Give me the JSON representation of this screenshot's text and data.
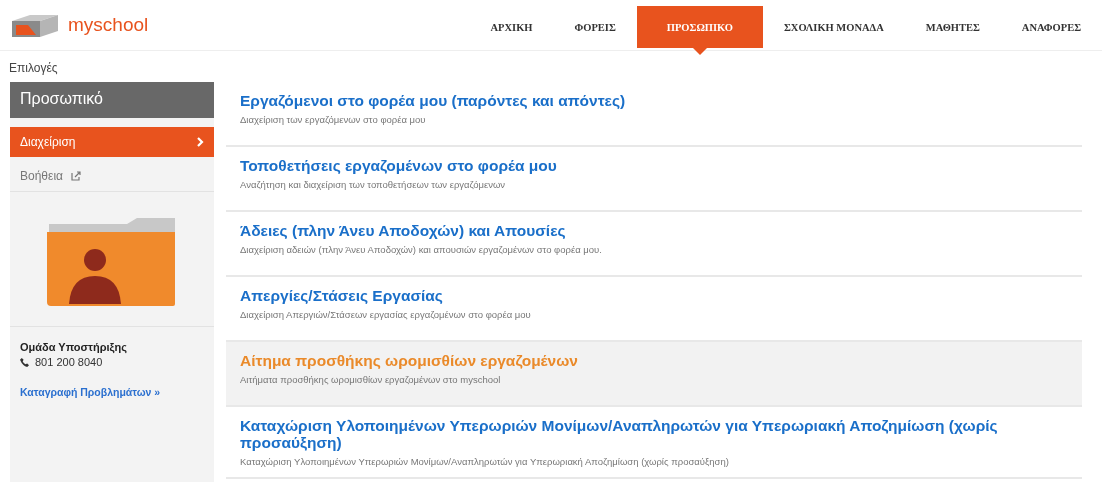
{
  "header": {
    "logo": "myschool",
    "nav": [
      {
        "label": "ΑΡΧΙΚΗ",
        "selected": false
      },
      {
        "label": "ΦΟΡΕΙΣ",
        "selected": false
      },
      {
        "label": "ΠΡΟΣΩΠΙΚΟ",
        "selected": true
      },
      {
        "label": "ΣΧΟΛΙΚΗ ΜΟΝΑΔΑ",
        "selected": false
      },
      {
        "label": "ΜΑΘΗΤΕΣ",
        "selected": false
      },
      {
        "label": "ΑΝΑΦΟΡΕΣ",
        "selected": false
      }
    ]
  },
  "breadcrumb": "Επιλογές",
  "sidebar": {
    "title": "Προσωπικό",
    "items": [
      {
        "label": "Διαχείριση",
        "selected": true,
        "kind": "arrow"
      },
      {
        "label": "Βοήθεια",
        "selected": false,
        "kind": "external"
      }
    ],
    "support": {
      "title": "Ομάδα Υποστήριξης",
      "phone": "801 200 8040",
      "link": "Καταγραφή Προβλημάτων »"
    }
  },
  "items": [
    {
      "title": "Εργαζόμενοι στο φορέα μου (παρόντες και απόντες)",
      "description": "Διαχείριση των εργαζόμενων στο φορέα μου",
      "highlighted": false
    },
    {
      "title": "Τοποθετήσεις εργαζομένων στο φορέα μου",
      "description": "Αναζήτηση και διαχείριση των τοποθετήσεων των εργαζόμενων",
      "highlighted": false
    },
    {
      "title": "Άδειες (πλην Άνευ Αποδοχών) και Απουσίες",
      "description": "Διαχείριση αδειών (πλην Άνευ Αποδοχών) και απουσιών εργαζομένων στο φορέα μου.",
      "highlighted": false
    },
    {
      "title": "Απεργίες/Στάσεις Εργασίας",
      "description": "Διαχείριση Απεργιών/Στάσεων εργασίας εργαζομένων στο φορέα μου",
      "highlighted": false
    },
    {
      "title": "Αίτημα προσθήκης ωρομισθίων εργαζομένων",
      "description": "Αιτήματα προσθήκης ωρομισθίων εργαζομένων στο myschool",
      "highlighted": true
    },
    {
      "title": "Καταχώριση Υλοποιημένων Υπερωριών Μονίμων/Αναπληρωτών για Υπερωριακή Αποζημίωση (χωρίς προσαύξηση)",
      "description": "Καταχώριση Υλοποιημένων Υπερωριών Μονίμων/Αναπληρωτών για Υπερωριακή Αποζημίωση (χωρίς προσαύξηση)",
      "highlighted": false
    }
  ]
}
